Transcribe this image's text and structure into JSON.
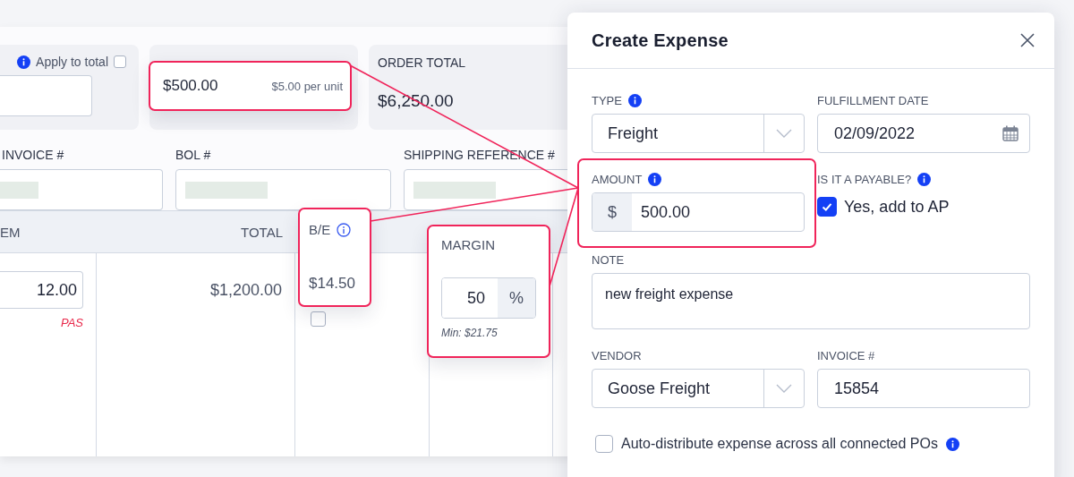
{
  "order": {
    "apply_to_total": {
      "label": "Apply to total",
      "checked": false
    },
    "order_total": {
      "label": "ORDER TOTAL",
      "value": "$6,250.00"
    },
    "fields": [
      {
        "label": "INVOICE #"
      },
      {
        "label": "BOL #"
      },
      {
        "label": "SHIPPING REFERENCE #"
      }
    ],
    "table": {
      "columns": [
        "EM",
        "TOTAL"
      ],
      "row": {
        "quantity": "12.00",
        "flag": "PAS",
        "total": "$1,200.00",
        "checked": false
      }
    }
  },
  "callouts": [
    {
      "kind": "expenses",
      "value": "$500.00",
      "note": "$5.00 per unit"
    },
    {
      "kind": "breakeven",
      "label": "B/E",
      "value": "$14.50"
    },
    {
      "kind": "margin",
      "label": "MARGIN",
      "value": "50",
      "unit": "%",
      "note": "Min: $21.75"
    }
  ],
  "dialog": {
    "title": "Create Expense",
    "fields": [
      {
        "kind": "select",
        "label": "TYPE",
        "info": true,
        "value": "Freight",
        "highlighted": false
      },
      {
        "kind": "date",
        "label": "FULFILLMENT DATE",
        "value": "02/09/2022",
        "highlighted": false
      },
      {
        "kind": "money",
        "label": "AMOUNT",
        "info": true,
        "prefix": "$",
        "value": "500.00",
        "highlighted": true
      },
      {
        "kind": "checkbox",
        "label": "IS IT A PAYABLE?",
        "info": true,
        "text": "Yes, add to AP",
        "checked": true,
        "highlighted": false
      },
      {
        "kind": "textarea",
        "label": "NOTE",
        "value": "new freight expense",
        "highlighted": false
      },
      {
        "kind": "select",
        "label": "VENDOR",
        "value": "Goose Freight",
        "highlighted": false
      },
      {
        "kind": "text",
        "label": "INVOICE #",
        "value": "15854",
        "highlighted": false
      }
    ],
    "auto_distribute": {
      "text": "Auto-distribute expense across all connected POs",
      "checked": false,
      "info": true
    }
  }
}
